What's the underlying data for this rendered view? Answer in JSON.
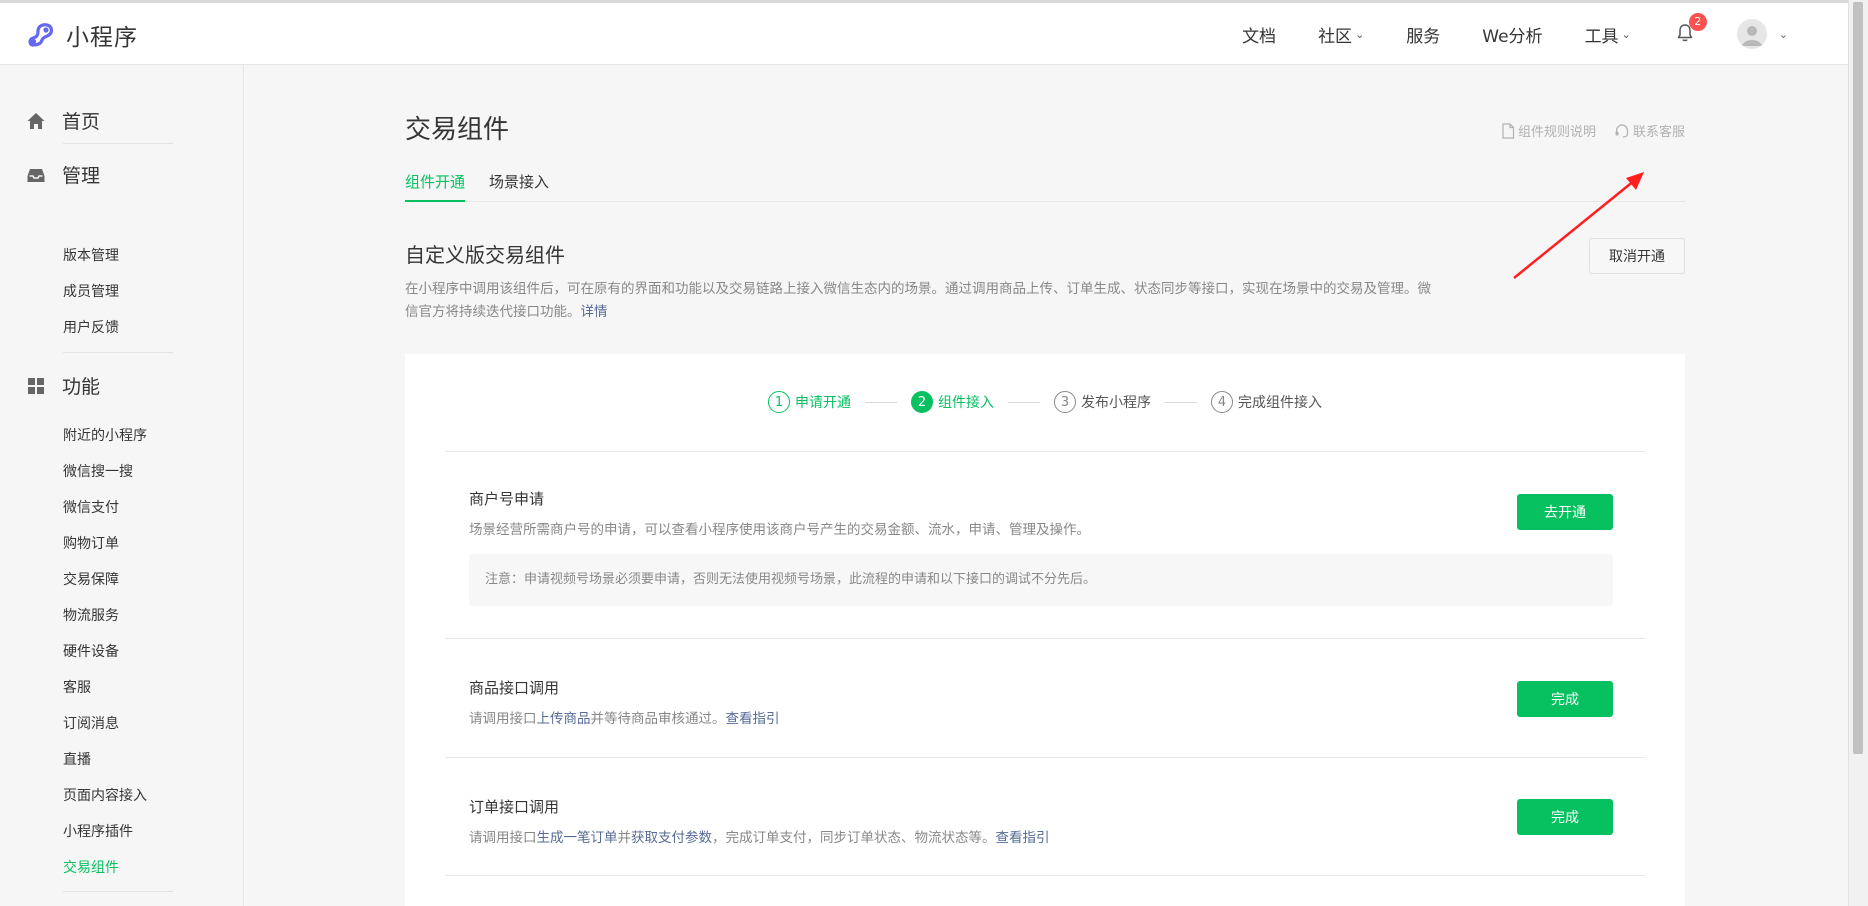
{
  "app": {
    "logo_text": "小程序",
    "brand_color": "#07c160",
    "logo_color": "#6467f0"
  },
  "topnav": {
    "items": [
      {
        "label": "文档",
        "has_dropdown": false
      },
      {
        "label": "社区",
        "has_dropdown": true
      },
      {
        "label": "服务",
        "has_dropdown": false
      },
      {
        "label": "We分析",
        "has_dropdown": false
      },
      {
        "label": "工具",
        "has_dropdown": true
      }
    ],
    "notification_count": "2",
    "icons": [
      "bell-icon",
      "avatar-icon",
      "chevron-down-icon"
    ]
  },
  "sidebar": {
    "home": {
      "label": "首页",
      "icon": "home-icon"
    },
    "manage": {
      "label": "管理",
      "icon": "inbox-icon",
      "items": [
        "版本管理",
        "成员管理",
        "用户反馈"
      ]
    },
    "features": {
      "label": "功能",
      "icon": "grid-icon",
      "items": [
        "附近的小程序",
        "微信搜一搜",
        "微信支付",
        "购物订单",
        "交易保障",
        "物流服务",
        "硬件设备",
        "客服",
        "订阅消息",
        "直播",
        "页面内容接入",
        "小程序插件",
        "交易组件"
      ],
      "active": "交易组件"
    }
  },
  "main": {
    "title": "交易组件",
    "links": {
      "rules": "组件规则说明",
      "support": "联系客服"
    },
    "tabs": [
      {
        "label": "组件开通",
        "active": true
      },
      {
        "label": "场景接入",
        "active": false
      }
    ],
    "section": {
      "title": "自定义版交易组件",
      "desc_line1": "在小程序中调用该组件后，可在原有的界面和功能以及交易链路上接入微信生态内的场景。通过调用商品上传、订单生成、状态同步等接口，实现在场景中的交易及管理。微",
      "desc_line2": "信官方将持续迭代接口功能。",
      "desc_link": "详情",
      "cancel_label": "取消开通"
    },
    "steps": [
      {
        "num": "1",
        "label": "申请开通",
        "state": "done"
      },
      {
        "num": "2",
        "label": "组件接入",
        "state": "current"
      },
      {
        "num": "3",
        "label": "发布小程序",
        "state": "todo"
      },
      {
        "num": "4",
        "label": "完成组件接入",
        "state": "todo"
      }
    ],
    "rows": [
      {
        "title": "商户号申请",
        "desc": "场景经营所需商户号的申请，可以查看小程序使用该商户号产生的交易金额、流水，申请、管理及操作。",
        "notice": "注意：申请视频号场景必须要申请，否则无法使用视频号场景，此流程的申请和以下接口的调试不分先后。",
        "button": "去开通"
      },
      {
        "title": "商品接口调用",
        "desc_prefix": "请调用接口",
        "desc_link1": "上传商品",
        "desc_mid": "并等待商品审核通过。",
        "desc_link2": "查看指引",
        "button": "完成"
      },
      {
        "title": "订单接口调用",
        "desc_prefix": "请调用接口",
        "desc_link1": "生成一笔订单",
        "desc_mid1": "并",
        "desc_link2": "获取支付参数",
        "desc_mid2": "，完成订单支付，同步订单状态、物流状态等。",
        "desc_link3": "查看指引",
        "button": "完成"
      }
    ]
  }
}
